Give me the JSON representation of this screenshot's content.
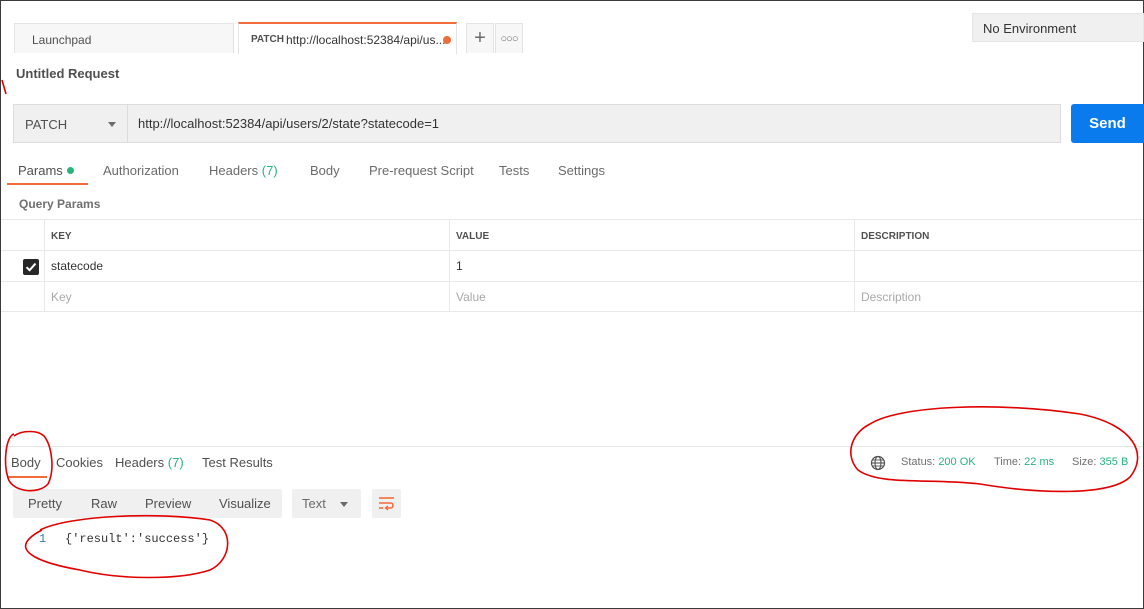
{
  "tabs": {
    "launchpad": "Launchpad",
    "active_method": "PATCH",
    "active_url": "http://localhost:52384/api/us...",
    "add_icon": "plus-icon",
    "more_icon": "ellipsis-icon"
  },
  "environment": "No Environment",
  "request": {
    "title": "Untitled Request",
    "method": "PATCH",
    "url": "http://localhost:52384/api/users/2/state?statecode=1",
    "send_label": "Send"
  },
  "request_tabs": {
    "params": "Params",
    "authorization": "Authorization",
    "headers": "Headers",
    "headers_count": "(7)",
    "body": "Body",
    "prerequest": "Pre-request Script",
    "tests": "Tests",
    "settings": "Settings"
  },
  "query_params": {
    "title": "Query Params",
    "headers": {
      "key": "KEY",
      "value": "VALUE",
      "description": "DESCRIPTION"
    },
    "rows": [
      {
        "checked": true,
        "key": "statecode",
        "value": "1",
        "description": ""
      }
    ],
    "placeholder": {
      "key": "Key",
      "value": "Value",
      "description": "Description"
    }
  },
  "response": {
    "tabs": {
      "body": "Body",
      "cookies": "Cookies",
      "headers": "Headers",
      "headers_count": "(7)",
      "test_results": "Test Results"
    },
    "status_label": "Status:",
    "status_value": "200 OK",
    "time_label": "Time:",
    "time_value": "22 ms",
    "size_label": "Size:",
    "size_value": "355 B",
    "formats": {
      "pretty": "Pretty",
      "raw": "Raw",
      "preview": "Preview",
      "visualize": "Visualize"
    },
    "language": "Text",
    "line_number": "1",
    "code": "{'result':'success'}"
  },
  "colors": {
    "accent": "#f26b3a",
    "send_blue": "#097bed",
    "success_green": "#26b47f",
    "annotation_red": "#e10000"
  }
}
